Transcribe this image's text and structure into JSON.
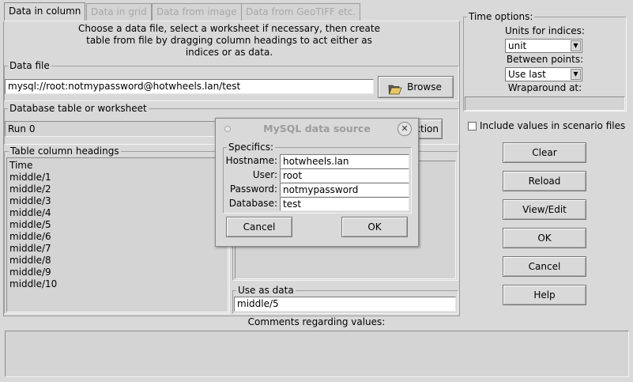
{
  "tabs": [
    {
      "label": "Data in column",
      "active": true
    },
    {
      "label": "Data in grid",
      "active": false
    },
    {
      "label": "Data from image",
      "active": false
    },
    {
      "label": "Data from GeoTIFF etc.",
      "active": false
    }
  ],
  "instructions": {
    "line1": "Choose a data file, select a worksheet if necessary, then create",
    "line2": "table from file by dragging column headings to act either as",
    "line3": "indices or as data."
  },
  "data_file": {
    "legend": "Data file",
    "value": "mysql://root:notmypassword@hotwheels.lan/test",
    "browse_label": "Browse",
    "browse_icon": "folder-open-icon"
  },
  "database_table": {
    "legend": "Database table or worksheet",
    "value": "Run 0",
    "partial_button_label": "ction"
  },
  "table_column_headings": {
    "legend": "Table column headings",
    "items": [
      "Time",
      "middle/1",
      "middle/2",
      "middle/3",
      "middle/4",
      "middle/5",
      "middle/6",
      "middle/7",
      "middle/8",
      "middle/9",
      "middle/10"
    ]
  },
  "use_as_data": {
    "legend": "Use as data",
    "value": "middle/5"
  },
  "comments": {
    "label": "Comments regarding values:",
    "value": ""
  },
  "time_options": {
    "legend": "Time options:",
    "units_label": "Units for indices:",
    "units_value": "unit",
    "between_label": "Between points:",
    "between_value": "Use last",
    "wrap_label": "Wraparound at:",
    "wrap_value": ""
  },
  "include_scenario": {
    "label": "Include values in scenario files",
    "checked": false
  },
  "side_buttons": {
    "clear": "Clear",
    "reload": "Reload",
    "view_edit": "View/Edit",
    "ok": "OK",
    "cancel": "Cancel",
    "help": "Help"
  },
  "mysql_dialog": {
    "title": "MySQL data source",
    "specifics_legend": "Specifics:",
    "hostname_label": "Hostname:",
    "hostname_value": "hotwheels.lan",
    "user_label": "User:",
    "user_value": "root",
    "password_label": "Password:",
    "password_value": "notmypassword",
    "database_label": "Database:",
    "database_value": "test",
    "cancel_label": "Cancel",
    "ok_label": "OK"
  },
  "colors": {
    "background": "#d9d9d9",
    "field": "#ffffff",
    "disabled_text": "#a8a8a8"
  }
}
